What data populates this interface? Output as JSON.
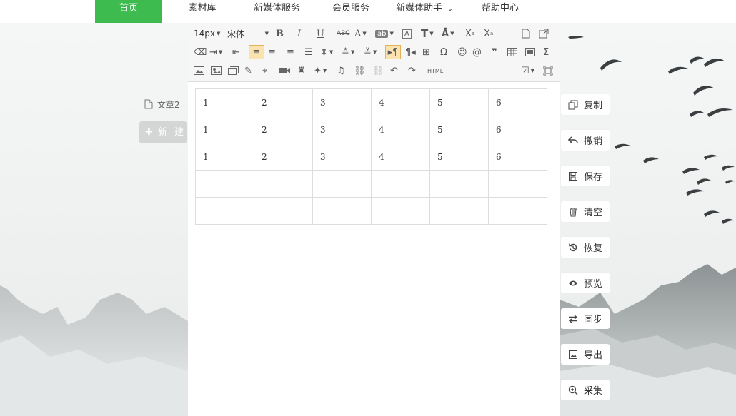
{
  "nav": {
    "items": [
      "首页",
      "素材库",
      "新媒体服务",
      "会员服务",
      "新媒体助手",
      "帮助中心"
    ],
    "active": "首页"
  },
  "sidebar": {
    "article": "文章2",
    "new_label": "新 建"
  },
  "toolbar": {
    "font_size": "14px",
    "font_family": "宋体",
    "html_label": "HTML"
  },
  "table": {
    "rows": [
      [
        "1",
        "2",
        "3",
        "4",
        "5",
        "6"
      ],
      [
        "1",
        "2",
        "3",
        "4",
        "5",
        "6"
      ],
      [
        "1",
        "2",
        "3",
        "4",
        "5",
        "6"
      ],
      [
        "",
        "",
        "",
        "",
        "",
        ""
      ],
      [
        "",
        "",
        "",
        "",
        "",
        ""
      ]
    ]
  },
  "actions": {
    "copy": "复制",
    "undo": "撤销",
    "save": "保存",
    "clear": "清空",
    "restore": "恢复",
    "preview": "预览",
    "sync": "同步",
    "export": "导出",
    "collect": "采集"
  },
  "colors": {
    "accent": "#3dbb4f",
    "highlight": "#fbe3b0"
  }
}
